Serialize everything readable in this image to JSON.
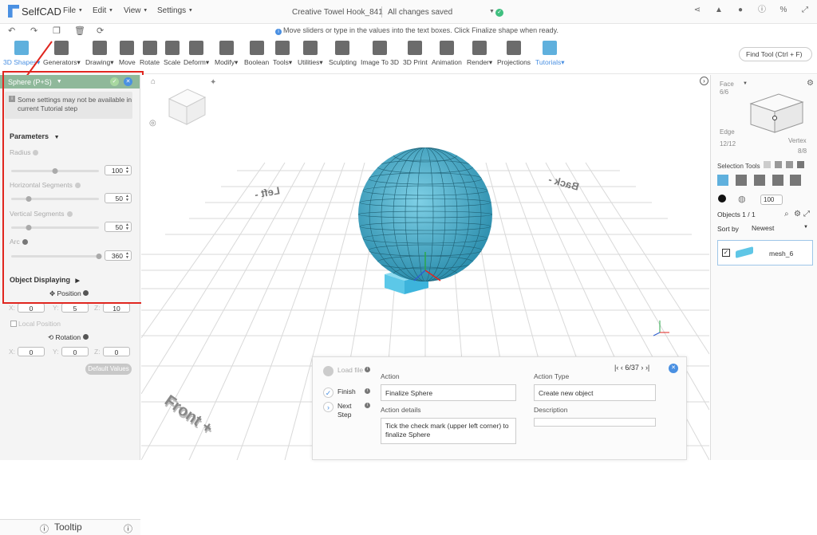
{
  "app": {
    "name": "SelfCAD"
  },
  "menus": [
    "File",
    "Edit",
    "View",
    "Settings"
  ],
  "document": {
    "title": "Creative Towel Hook_841",
    "status": "All changes saved"
  },
  "hint_message": "Move sliders or type in the values into the text boxes. Click Finalize shape when ready.",
  "toolbar": {
    "items": [
      "3D Shapes",
      "Generators",
      "Drawing",
      "Move",
      "Rotate",
      "Scale",
      "Deform",
      "Modify",
      "Boolean",
      "Tools",
      "Utilities",
      "Sculpting",
      "Image To 3D",
      "3D Print",
      "Animation",
      "Render",
      "Projections",
      "Tutorials"
    ],
    "find_tool": "Find Tool (Ctrl + F)"
  },
  "left_panel": {
    "header": "Sphere (P+S)",
    "notice": "Some settings may not be available in current Tutorial step",
    "parameters_title": "Parameters",
    "radius": {
      "label": "Radius",
      "value": "100",
      "level": 0.5
    },
    "h_segments": {
      "label": "Horizontal Segments",
      "value": "50",
      "level": 0.2
    },
    "v_segments": {
      "label": "Vertical Segments",
      "value": "50",
      "level": 0.2
    },
    "arc": {
      "label": "Arc",
      "value": "360",
      "level": 1.0
    },
    "object_displaying": "Object Displaying",
    "position_label": "Position",
    "position": {
      "x": "0",
      "y": "5",
      "z": "10"
    },
    "local_position": "Local Position",
    "rotation_label": "Rotation",
    "rotation": {
      "x": "0",
      "y": "0",
      "z": "0"
    },
    "axis_x": "X:",
    "axis_y": "Y:",
    "axis_z": "Z:",
    "default_values": "Default Values",
    "tooltip": "Tooltip"
  },
  "viewport": {
    "labels": [
      "Left -",
      "Back -",
      "Front +"
    ]
  },
  "right_panel": {
    "face_label": "Face",
    "face_count": "6/6",
    "edge_label": "Edge",
    "edge_count": "12/12",
    "vertex_label": "Vertex",
    "vertex_count": "8/8",
    "selection_tools": "Selection Tools",
    "brush_size": "100",
    "objects": "Objects 1 / 1",
    "sort_by": "Sort by",
    "sort_value": "Newest",
    "object_name": "mesh_6"
  },
  "tutorial": {
    "steps": [
      "Load file",
      "Finish",
      "Next Step"
    ],
    "counter": "6/37",
    "action_label": "Action",
    "action_value": "Finalize Sphere",
    "action_details_label": "Action details",
    "action_details_value": "Tick the check mark (upper left corner) to finalize Sphere",
    "action_type_label": "Action Type",
    "action_type_value": "Create new object",
    "description_label": "Description",
    "description_value": ""
  },
  "colors": {
    "accent": "#4a90e2",
    "sphere": "#4bb3cf",
    "highlight": "#e0261f",
    "panel_header": "#8fb89a"
  }
}
